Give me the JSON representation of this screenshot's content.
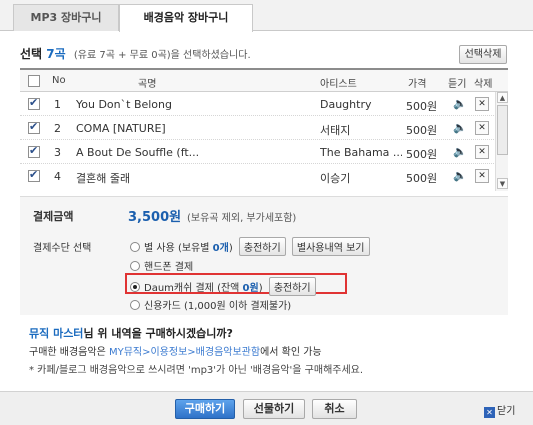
{
  "tabs": [
    {
      "label": "MP3 장바구니"
    },
    {
      "label": "배경음악 장바구니"
    }
  ],
  "selection": {
    "prefix": "선택",
    "count": "7곡",
    "note": "(유료 7곡 + 무료 0곡)을 선택하셨습니다.",
    "delete_label": "선택삭제"
  },
  "table": {
    "headers": {
      "no": "No",
      "title": "곡명",
      "artist": "아티스트",
      "price": "가격",
      "listen": "듣기",
      "delete": "삭제"
    },
    "rows": [
      {
        "no": "1",
        "title": "You Don`t Belong",
        "artist": "Daughtry",
        "price": "500원",
        "checked": true
      },
      {
        "no": "2",
        "title": "COMA [NATURE]",
        "artist": "서태지",
        "price": "500원",
        "checked": true
      },
      {
        "no": "3",
        "title": "A Bout De Souffle (ft...",
        "artist": "The Bahama ...",
        "price": "500원",
        "checked": true
      },
      {
        "no": "4",
        "title": "결혼해 줄래",
        "artist": "이승기",
        "price": "500원",
        "checked": true
      }
    ]
  },
  "payment": {
    "amount_label": "결제금액",
    "amount": "3,500원",
    "amount_note": "(보유곡 제외, 부가세포함)",
    "method_label": "결제수단 선택",
    "star": {
      "text_a": "별 사용 (보유별 ",
      "count": "0개",
      "text_b": ")",
      "charge_label": "충전하기",
      "history_label": "별사용내역 보기"
    },
    "phone": {
      "label": "핸드폰 결제"
    },
    "daum": {
      "text_a": "Daum캐쉬 결제 (잔액 ",
      "balance": "0원",
      "text_b": ")",
      "charge_label": "충전하기"
    },
    "card": {
      "label": "신용카드 (1,000원 이하 결제불가)"
    }
  },
  "info": {
    "title_highlight": "뮤직 마스터",
    "title_rest": "님 위 내역을 구매하시겠습니까?",
    "line_a": "구매한 배경음악은 ",
    "path": "MY뮤직>이용정보>배경음악보관함",
    "line_b": "에서 확인 가능",
    "note": "* 카페/블로그 배경음악으로 쓰시려면 'mp3'가 아닌 '배경음악'을 구매해주세요."
  },
  "footer": {
    "buy_label": "구매하기",
    "gift_label": "선물하기",
    "cancel_label": "취소",
    "close_label": "닫기"
  },
  "colors": {
    "accent": "#1b6bbf",
    "highlight_box": "#e03333",
    "buy_button": "#2f72c8"
  }
}
